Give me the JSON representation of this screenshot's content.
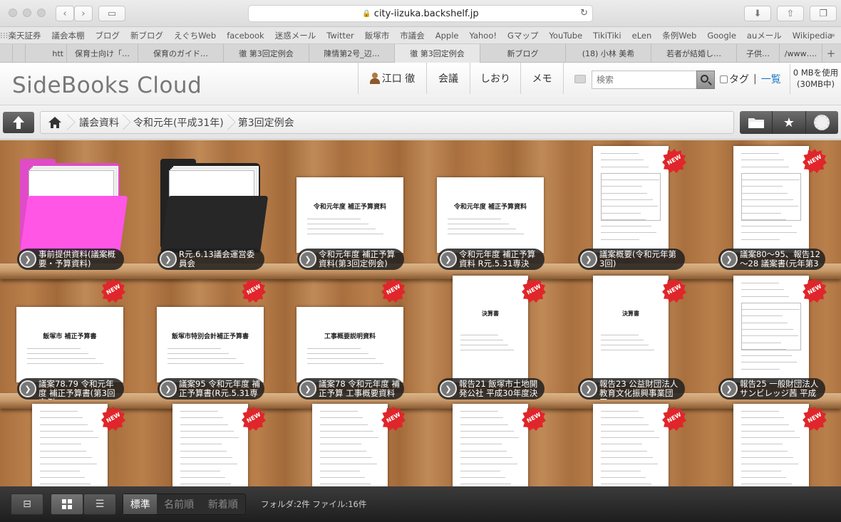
{
  "browser": {
    "url": "city-iizuka.backshelf.jp",
    "bookmarks": [
      "楽天証券",
      "議会本棚",
      "ブログ",
      "新ブログ",
      "えぐちWeb",
      "facebook",
      "迷惑メール",
      "Twitter",
      "飯塚市",
      "市議会",
      "Apple",
      "Yahoo!",
      "Gマップ",
      "YouTube",
      "TikiTiki",
      "eLen",
      "条例Web",
      "Google",
      "auメール",
      "Wikipedia"
    ],
    "tabs": [
      "htt",
      "保育士向け「…",
      "保育のガイド…",
      "徹 第3回定例会",
      "陳情第2号_辺…",
      "徹 第3回定例会",
      "新ブログ",
      "(18) 小林 美希",
      "若者が結婚し…",
      "子供…",
      "/www…."
    ]
  },
  "app": {
    "logo": "SideBooks Cloud",
    "user_name": "江口 徹",
    "nav": [
      "会議",
      "しおり",
      "メモ"
    ],
    "search_placeholder": "検索",
    "tag_label": "タグ",
    "list_label": "一覧",
    "usage_line1": "0 MBを使用",
    "usage_line2": "(30MB中)"
  },
  "breadcrumbs": [
    "議会資料",
    "令和元年(平成31年)",
    "第3回定例会"
  ],
  "badge_text": "NEW",
  "shelf": {
    "row1": [
      {
        "type": "folder",
        "color": "#e04bc8",
        "label": "事前提供資料(議案概要・予算資料)",
        "new": false
      },
      {
        "type": "folder",
        "color": "#222222",
        "label": "R元.6.13議会運営委員会",
        "new": false
      },
      {
        "type": "doc",
        "label": "令和元年度 補正予算資料(第3回定例会)",
        "new": false,
        "heading": "令和元年度 補正予算資料"
      },
      {
        "type": "doc",
        "label": "令和元年度 補正予算資料 R元.5.31専決",
        "new": false,
        "heading": "令和元年度 補正予算資料"
      },
      {
        "type": "doc",
        "label": "議案概要(令和元年第3回)",
        "new": true,
        "heading": ""
      },
      {
        "type": "doc",
        "label": "議案80～95、報告12～28 議案書(元年第3",
        "new": true,
        "heading": ""
      }
    ],
    "row2": [
      {
        "type": "doc",
        "label": "議案78.79 令和元年度 補正予算書(第3回定例",
        "new": true,
        "heading": "飯塚市 補正予算書"
      },
      {
        "type": "doc",
        "label": "議案95 令和元年度 補正予算書(R元.5.31専",
        "new": true,
        "heading": "飯塚市特別会計補正予算書"
      },
      {
        "type": "doc",
        "label": "議案78 令和元年度 補正予算 工事概要資料",
        "new": true,
        "heading": "工事概要説明資料"
      },
      {
        "type": "doc",
        "label": "報告21 飯塚市土地開発公社 平成30年度決",
        "new": true,
        "heading": "決算書"
      },
      {
        "type": "doc",
        "label": "報告23 公益財団法人 教育文化振興事業団 平",
        "new": true,
        "heading": "決算書"
      },
      {
        "type": "doc",
        "label": "報告25 一般財団法人 サンビレッジ茜 平成",
        "new": true,
        "heading": ""
      }
    ],
    "row3": [
      {
        "type": "doc",
        "label": "",
        "new": true,
        "heading": ""
      },
      {
        "type": "doc",
        "label": "",
        "new": true,
        "heading": ""
      },
      {
        "type": "doc",
        "label": "",
        "new": true,
        "heading": ""
      },
      {
        "type": "doc",
        "label": "",
        "new": true,
        "heading": ""
      },
      {
        "type": "doc",
        "label": "",
        "new": true,
        "heading": ""
      },
      {
        "type": "doc",
        "label": "",
        "new": true,
        "heading": ""
      }
    ]
  },
  "bottom": {
    "sort": [
      "標準",
      "名前順",
      "新着順"
    ],
    "status": "フォルダ:2件 ファイル:16件"
  }
}
